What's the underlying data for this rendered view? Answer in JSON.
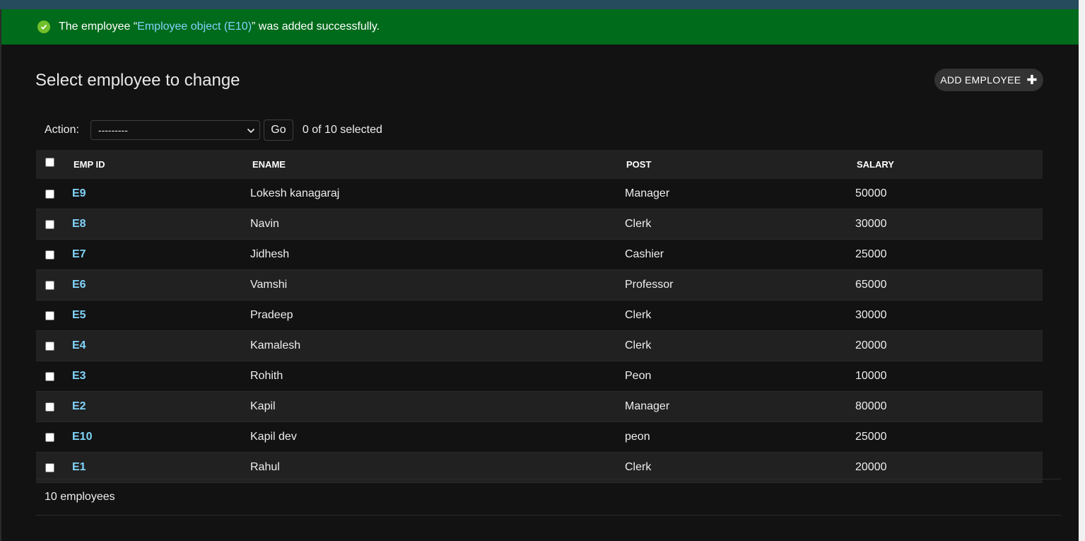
{
  "message": {
    "prefix": "The employee “",
    "link_text": "Employee object (E10)",
    "suffix": "” was added successfully."
  },
  "header": {
    "title": "Select employee to change",
    "add_button_label": "ADD EMPLOYEE"
  },
  "actions": {
    "label": "Action:",
    "select_value": "---------",
    "go_label": "Go",
    "selected_text": "0 of 10 selected"
  },
  "table": {
    "columns": [
      "EMP ID",
      "ENAME",
      "POST",
      "SALARY"
    ],
    "rows": [
      {
        "emp_id": "E9",
        "ename": "Lokesh kanagaraj",
        "post": "Manager",
        "salary": "50000"
      },
      {
        "emp_id": "E8",
        "ename": "Navin",
        "post": "Clerk",
        "salary": "30000"
      },
      {
        "emp_id": "E7",
        "ename": "Jidhesh",
        "post": "Cashier",
        "salary": "25000"
      },
      {
        "emp_id": "E6",
        "ename": "Vamshi",
        "post": "Professor",
        "salary": "65000"
      },
      {
        "emp_id": "E5",
        "ename": "Pradeep",
        "post": "Clerk",
        "salary": "30000"
      },
      {
        "emp_id": "E4",
        "ename": "Kamalesh",
        "post": "Clerk",
        "salary": "20000"
      },
      {
        "emp_id": "E3",
        "ename": "Rohith",
        "post": "Peon",
        "salary": "10000"
      },
      {
        "emp_id": "E2",
        "ename": "Kapil",
        "post": "Manager",
        "salary": "80000"
      },
      {
        "emp_id": "E10",
        "ename": "Kapil dev",
        "post": "peon",
        "salary": "25000"
      },
      {
        "emp_id": "E1",
        "ename": "Rahul",
        "post": "Clerk",
        "salary": "20000"
      }
    ]
  },
  "paginator": {
    "count_text": "10 employees"
  },
  "colors": {
    "success_bg": "#006b1b",
    "link": "#81d4fa",
    "header_bar": "#264b5d"
  }
}
